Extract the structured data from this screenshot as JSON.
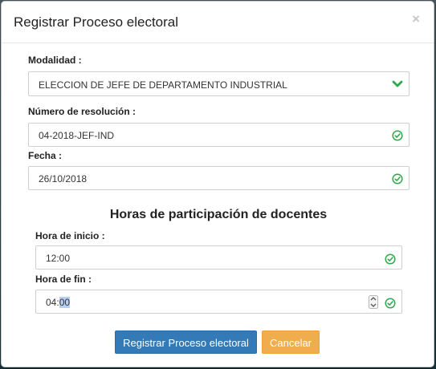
{
  "modal": {
    "title": "Registrar Proceso electoral",
    "close_symbol": "×"
  },
  "fields": {
    "modalidad": {
      "label": "Modalidad :",
      "value": "ELECCION DE JEFE DE DEPARTAMENTO INDUSTRIAL",
      "icon": "chevron-down-icon"
    },
    "resolucion": {
      "label": "Número de resolución :",
      "value": "04-2018-JEF-IND",
      "icon": "check-circle-icon"
    },
    "fecha": {
      "label": "Fecha :",
      "value": "26/10/2018",
      "icon": "check-circle-icon"
    }
  },
  "section": {
    "title": "Horas de participación de docentes"
  },
  "horas": {
    "inicio": {
      "label": "Hora de inicio :",
      "value": "12:00"
    },
    "fin": {
      "label": "Hora de fin :",
      "value_hours": "04:",
      "value_minutes_selected": "00"
    }
  },
  "buttons": {
    "submit": "Registrar Proceso electoral",
    "cancel": "Cancelar"
  },
  "colors": {
    "accent": "#337ab7",
    "warning": "#f0ad4e",
    "success": "#2ea84a"
  }
}
